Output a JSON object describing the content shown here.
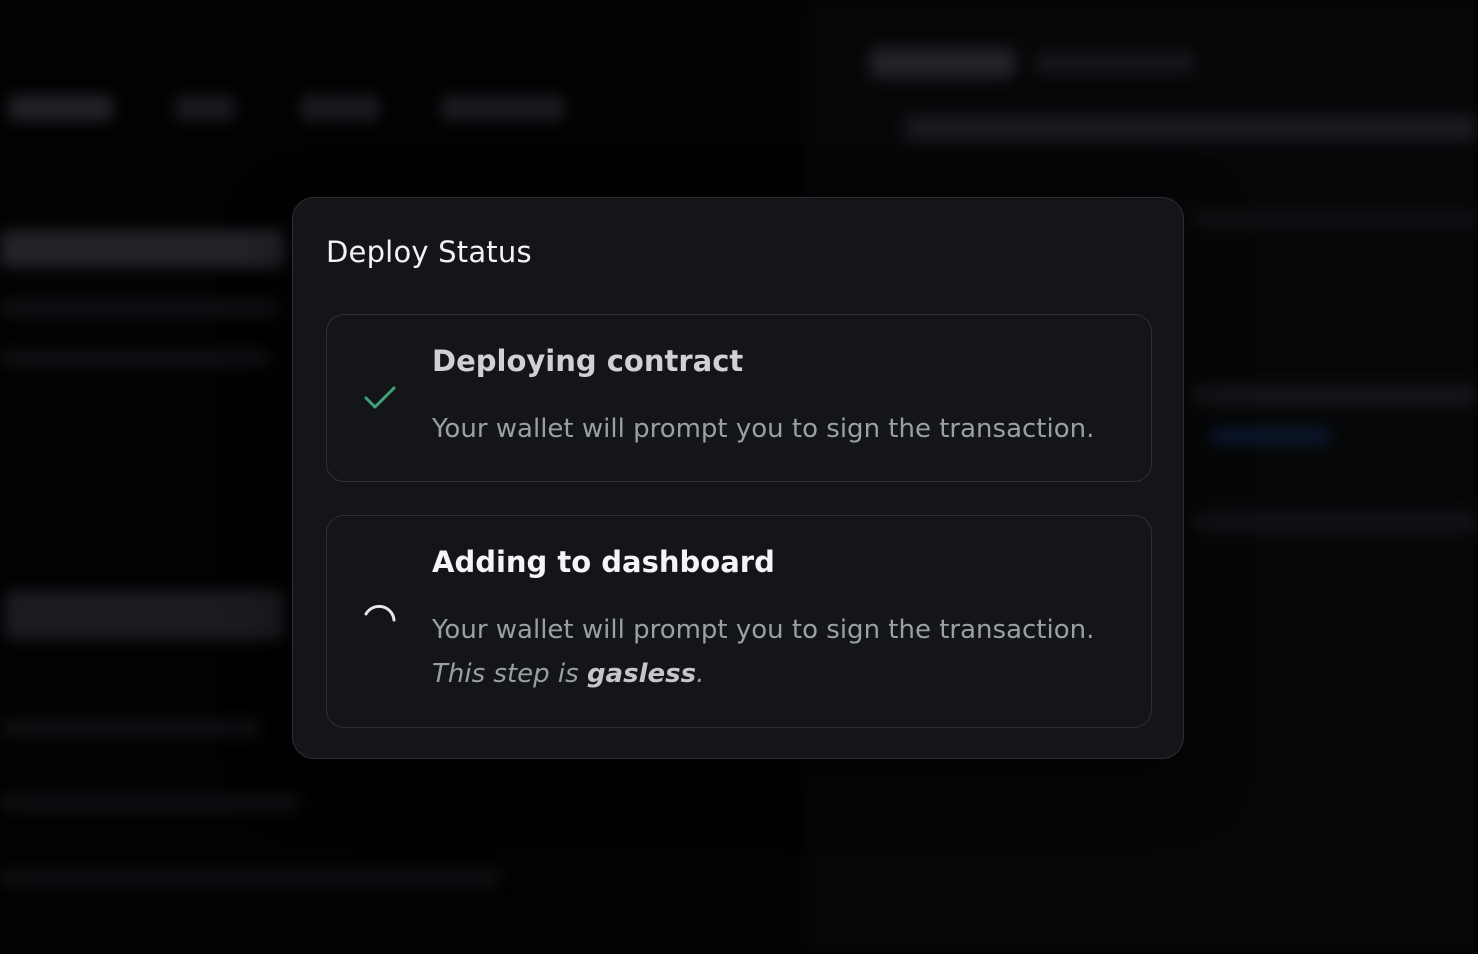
{
  "modal": {
    "title": "Deploy Status"
  },
  "steps": [
    {
      "status": "complete",
      "icon": "check-icon",
      "title": "Deploying contract",
      "description": "Your wallet will prompt you to sign the transaction."
    },
    {
      "status": "in-progress",
      "icon": "spinner-icon",
      "title": "Adding to dashboard",
      "description": "Your wallet will prompt you to sign the transaction.",
      "note_prefix": "This step is ",
      "note_emphasis": "gasless",
      "note_suffix": "."
    }
  ],
  "colors": {
    "modal_bg": "#141518",
    "border": "#2e3035",
    "check": "#3fa37a",
    "text_primary": "#f4f5f7",
    "text_secondary": "#9b9ea6"
  }
}
